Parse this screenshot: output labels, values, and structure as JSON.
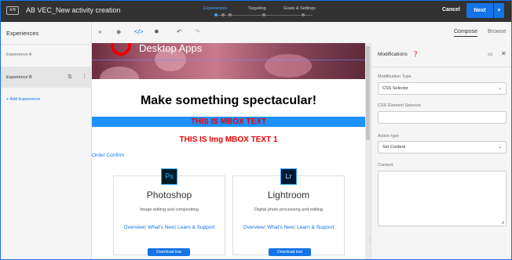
{
  "topbar": {
    "badge": "A/B",
    "title": "AB VEC_New activity creation",
    "steps": [
      {
        "label": "Experiences",
        "active": true
      },
      {
        "label": "Targeting",
        "active": false
      },
      {
        "label": "Goals & Settings",
        "active": false
      }
    ],
    "cancel_label": "Cancel",
    "next_label": "Next",
    "next_dropdown_icon": "▾",
    "accent": "#1473e6"
  },
  "experiences": {
    "title": "Experiences",
    "items": [
      {
        "label": "Experience A",
        "selected": false
      },
      {
        "label": "Experience B",
        "selected": true
      }
    ],
    "sort_icon": "⇅",
    "more_icon": "⋮",
    "add_label": "+ Add Experience"
  },
  "toolbar": {
    "icons": [
      {
        "name": "collapse-icon",
        "glyph": "«"
      },
      {
        "name": "layers-icon",
        "glyph": "◈"
      },
      {
        "name": "code-icon",
        "glyph": "</>"
      },
      {
        "name": "settings-icon",
        "glyph": "✸"
      },
      {
        "name": "undo-icon",
        "glyph": "↶"
      },
      {
        "name": "redo-icon",
        "glyph": "↷"
      }
    ],
    "compose_label": "Compose",
    "browse_label": "Browse"
  },
  "canvas": {
    "hero_text": "Desktop Apps",
    "headline": "Make something spectacular!",
    "mbox_text": "THIS IS MBOX TEXT",
    "img_mbox_text": "THIS IS Img MBOX TEXT 1",
    "order_confirm": "Order Confirm",
    "cards": [
      {
        "icon": "Ps",
        "name": "Photoshop",
        "desc": "Image editing and compositing",
        "links": [
          "Overview",
          "What's New",
          "Learn & Support"
        ],
        "button": "Download trial"
      },
      {
        "icon": "Lr",
        "name": "Lightroom",
        "desc": "Digital photo processing and editing",
        "links": [
          "Overview",
          "What's New",
          "Learn & Support"
        ],
        "button": "Download trial"
      }
    ],
    "link_separator": "|"
  },
  "modifications": {
    "title": "Modifications",
    "info_icon": "❓",
    "dock_icon": "▭",
    "close_icon": "✕",
    "mod_type_label": "Modification Type",
    "mod_type_value": "CSS Selector",
    "css_selector_label": "CSS Element Selector",
    "css_selector_value": "",
    "action_type_label": "Action type",
    "action_type_value": "Set Content",
    "content_label": "Content",
    "content_value": "",
    "chevron": "⌄"
  }
}
